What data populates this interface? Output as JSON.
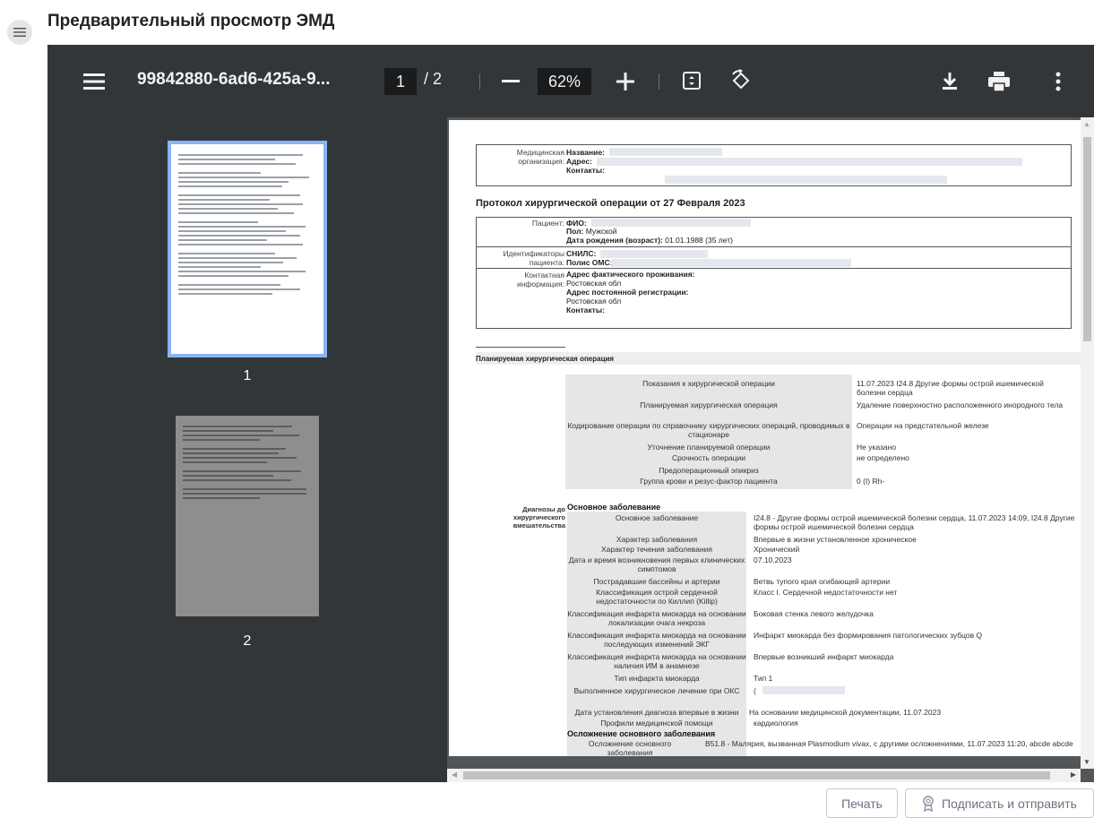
{
  "page_title": "Предварительный просмотр ЭМД",
  "toolbar": {
    "filename": "99842880-6ad6-425a-9...",
    "current_page": "1",
    "page_separator": "/",
    "total_pages": "2",
    "zoom": "62%"
  },
  "thumbnails": [
    {
      "number": "1"
    },
    {
      "number": "2"
    }
  ],
  "doc": {
    "org_label": "Медицинская организация:",
    "org_name_label": "Название:",
    "org_address_label": "Адрес:",
    "org_contacts_label": "Контакты:",
    "protocol_title": "Протокол хирургической операции от 27 Февраля 2023",
    "patient_label": "Пациент:",
    "fio_label": "ФИО:",
    "sex_label": "Пол:",
    "sex_value": "Мужской",
    "dob_label": "Дата рождения (возраст):",
    "dob_value": "01.01.1988 (35 лет)",
    "ids_label": "Идентификаторы пациента:",
    "snils_label": "СНИЛС:",
    "oms_label": "Полис ОМС:",
    "contact_label": "Контактная информация:",
    "fact_addr_label": "Адрес фактического проживания:",
    "fact_addr_value": "Ростовская обл",
    "reg_addr_label": "Адрес постоянной регистрации:",
    "reg_addr_value": "Ростовская обл",
    "contacts_label": "Контакты:",
    "planned_section": "Планируемая хирургическая операция",
    "planned_rows": [
      {
        "label": "Показания к хирургической операции",
        "value": "11.07.2023 I24.8 Другие формы острой ишемической болезни сердца"
      },
      {
        "label": "Планируемая хирургическая операция",
        "value": "Удаление поверхностно расположенного инородного тела"
      },
      {
        "label": "Кодирование операции по справочнику хирургических операций, проводимых в стационаре",
        "value": "Операции на предстательной железе"
      },
      {
        "label": "Уточнение планируемой операции",
        "value": "Не указано"
      },
      {
        "label": "Срочность операции",
        "value": "не определено"
      },
      {
        "label": "Предоперационный эпикриз",
        "value": ""
      },
      {
        "label": "Группа крови и резус-фактор пациента",
        "value": "0 (I) Rh-"
      }
    ],
    "diag_side_label": "Диагнозы до хирургического вмешательства",
    "main_disease_heading": "Основное заболевание",
    "diag_rows": [
      {
        "label": "Основное заболевание",
        "value": "I24.8 - Другие формы острой ишемической болезни сердца, 11.07.2023 14:09, I24.8 Другие формы острой ишемической болезни сердца"
      },
      {
        "label": "Характер заболевания",
        "value": "Впервые в жизни установленное хроническое"
      },
      {
        "label": "Характер течения заболевания",
        "value": "Хронический"
      },
      {
        "label": "Дата и время возникновения первых клинических симптомов",
        "value": "07.10.2023"
      },
      {
        "label": "Пострадавшие бассейны и артерии",
        "value": "Ветвь тупого края огибающей артерии"
      },
      {
        "label": "Классификация острой сердечной недостаточности по Киллип (Killip)",
        "value": "Класс I. Сердечной недостаточности нет"
      },
      {
        "label": "Классификация инфаркта миокарда на основании локализации очага некроза",
        "value": "Боковая стенка левого желудочка"
      },
      {
        "label": "Классификация инфаркта миокарда на основании последующих изменений ЭКГ",
        "value": "Инфаркт миокарда без формирования патологических зубцов Q"
      },
      {
        "label": "Классификация инфаркта миокарда на основании наличия ИМ в анамнезе",
        "value": "Впервые возникший инфаркт миокарда"
      },
      {
        "label": "Тип инфаркта миокарда",
        "value": "Тип 1"
      },
      {
        "label": "Выполненное хирургическое лечение при ОКС",
        "value": "("
      },
      {
        "label": "Дата установления диагноза впервые в жизни",
        "value": "На основании медицинской документации, 11.07.2023"
      },
      {
        "label": "Профили медицинской помощи",
        "value": "кардиология"
      }
    ],
    "complication_heading": "Осложнение основного заболевания",
    "complication_label": "Осложнение основного заболевания",
    "complication_value": "B51.8 - Малярия, вызванная Plasmodium vivax, с другими осложнениями, 11.07.2023 11:20, abcde abcde"
  },
  "footer": {
    "print_label": "Печать",
    "sign_label": "Подписать и отправить"
  }
}
